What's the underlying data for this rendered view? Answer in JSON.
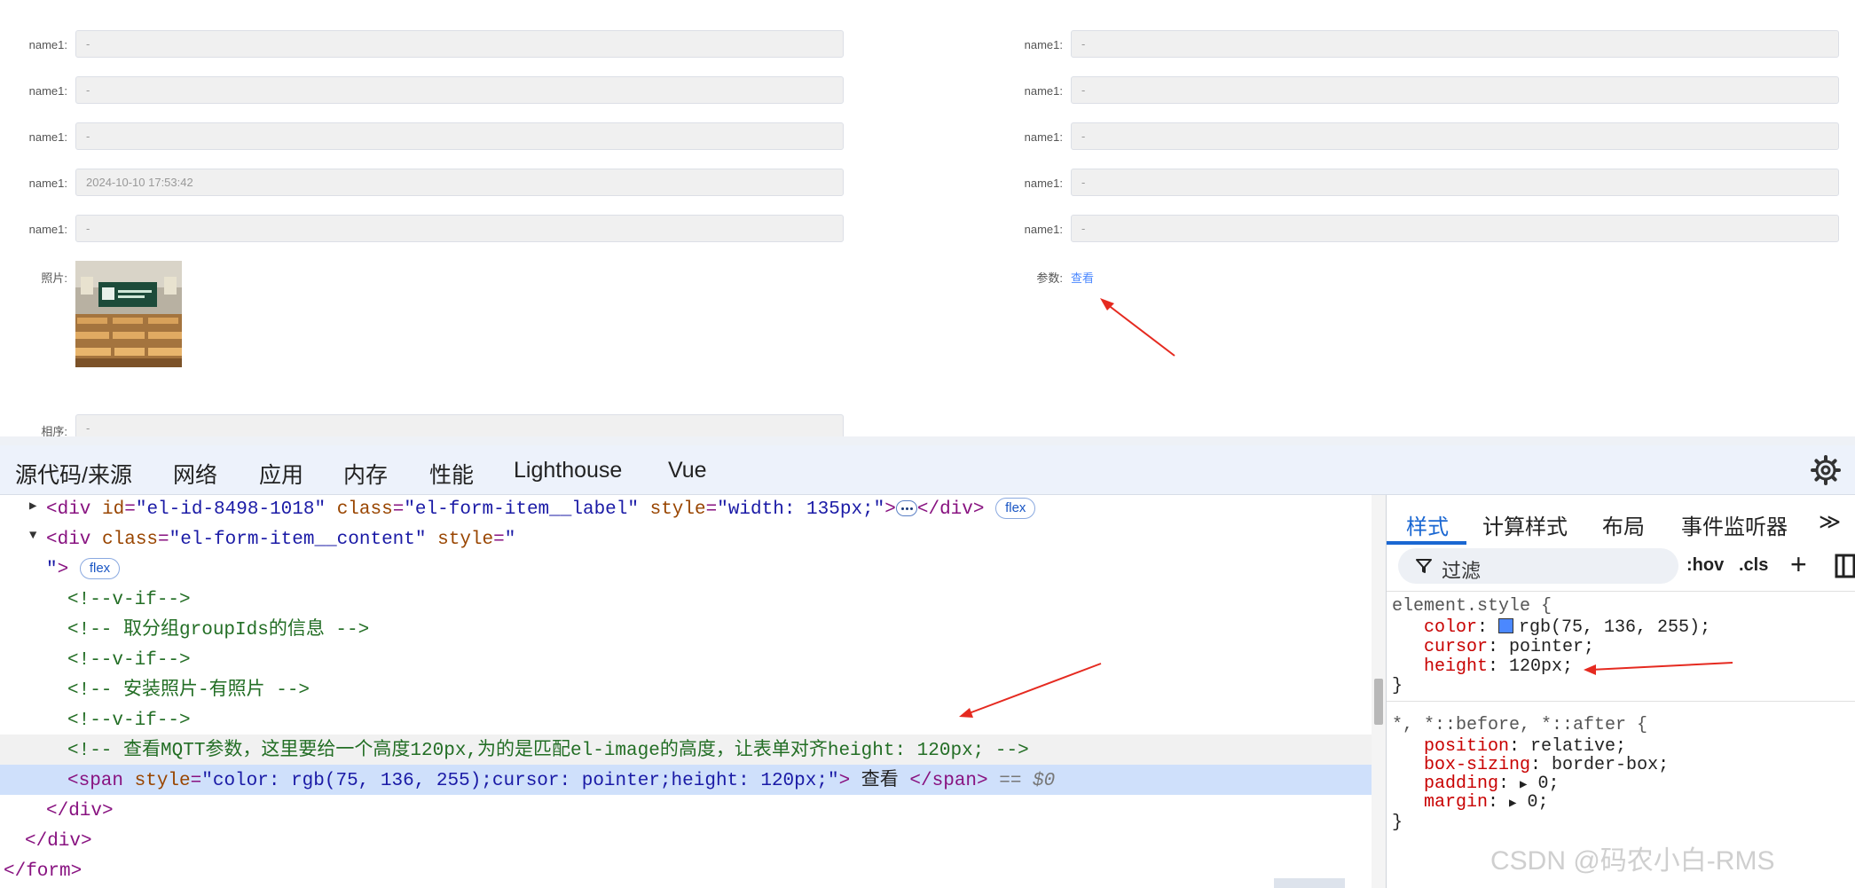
{
  "form": {
    "left_labels": [
      "name1:",
      "name1:",
      "name1:",
      "name1:",
      "name1:"
    ],
    "left_values": [
      "-",
      "-",
      "-",
      "2024-10-10 17:53:42",
      "-"
    ],
    "right_labels": [
      "name1:",
      "name1:",
      "name1:",
      "name1:",
      "name1:"
    ],
    "right_values": [
      "-",
      "-",
      "-",
      "-",
      "-"
    ],
    "photo_label": "照片:",
    "param_label": "参数:",
    "param_link": "查看",
    "order_label": "相序:",
    "order_value": "-"
  },
  "devtools": {
    "tabs": [
      "源代码/来源",
      "网络",
      "应用",
      "内存",
      "性能",
      "Lighthouse",
      "Vue"
    ],
    "elements": {
      "line1": {
        "attr1_name": "id",
        "attr1_value": "\"el-id-8498-1018\"",
        "attr2_name": "class",
        "attr2_value": "\"el-form-item__label\"",
        "attr3_name": "style",
        "attr3_value": "\"width: 135px;\"",
        "badge": "flex"
      },
      "line2": {
        "attr_name": "class",
        "attr_value": "\"el-form-item__content\"",
        "attr2_name": "style",
        "attr2_value_start": "\""
      },
      "line3": {
        "attr2_value_end": "\"",
        "badge": "flex"
      },
      "comments": [
        "<!--v-if-->",
        "<!-- 取分组groupIds的信息 -->",
        "<!--v-if-->",
        "<!-- 安装照片-有照片 -->",
        "<!--v-if-->",
        "<!-- 查看MQTT参数，这里要给一个高度120px,为的是匹配el-image的高度，让表单对齐height: 120px; -->"
      ],
      "span_line": {
        "attr_name": "style",
        "attr_value": "\"color: rgb(75, 136, 255);cursor: pointer;height: 120px;\"",
        "text": " 查看 ",
        "dollar": "== $0"
      }
    },
    "styles_panel": {
      "tabs": [
        "样式",
        "计算样式",
        "布局",
        "事件监听器"
      ],
      "more": "≫",
      "filter": "过滤",
      "hov": ":hov",
      "cls": ".cls",
      "plus": "+",
      "rule1": {
        "selector": "element.style {",
        "props": [
          {
            "name": "color",
            "value": "rgb(75, 136, 255);"
          },
          {
            "name": "cursor",
            "value": "pointer;"
          },
          {
            "name": "height",
            "value": "120px;"
          }
        ],
        "close": "}"
      },
      "rule2": {
        "selector": "*, *::before, *::after {",
        "props": [
          {
            "name": "position",
            "value": "relative;"
          },
          {
            "name": "box-sizing",
            "value": "border-box;"
          },
          {
            "name": "padding",
            "value": "0;"
          },
          {
            "name": "margin",
            "value": "0;"
          }
        ],
        "close": "}"
      },
      "swatch_color": "#4b88ff"
    }
  },
  "watermark": "CSDN @码农小白-RMS"
}
